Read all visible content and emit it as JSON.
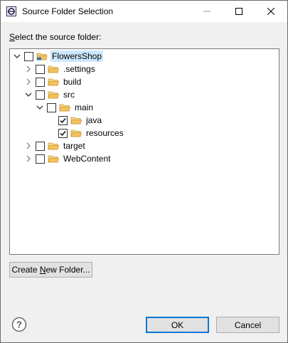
{
  "window": {
    "title": "Source Folder Selection"
  },
  "prompt": {
    "mnemonic": "S",
    "rest": "elect the source folder:"
  },
  "tree": [
    {
      "label": "FlowersShop",
      "level": 0,
      "expanded": true,
      "checked": false,
      "icon": "project-folder-icon",
      "selected": true
    },
    {
      "label": ".settings",
      "level": 1,
      "expanded": false,
      "checked": false,
      "icon": "folder-icon"
    },
    {
      "label": "build",
      "level": 1,
      "expanded": false,
      "checked": false,
      "icon": "folder-icon"
    },
    {
      "label": "src",
      "level": 1,
      "expanded": true,
      "checked": false,
      "icon": "folder-icon"
    },
    {
      "label": "main",
      "level": 2,
      "expanded": true,
      "checked": false,
      "icon": "folder-icon"
    },
    {
      "label": "java",
      "level": 3,
      "expanded": null,
      "checked": true,
      "icon": "folder-icon"
    },
    {
      "label": "resources",
      "level": 3,
      "expanded": null,
      "checked": true,
      "icon": "folder-icon"
    },
    {
      "label": "target",
      "level": 1,
      "expanded": false,
      "checked": false,
      "icon": "folder-icon"
    },
    {
      "label": "WebContent",
      "level": 1,
      "expanded": false,
      "checked": false,
      "icon": "folder-icon"
    }
  ],
  "buttons": {
    "create_prefix": "Create ",
    "create_mnemonic": "N",
    "create_suffix": "ew Folder...",
    "ok": "OK",
    "cancel": "Cancel"
  },
  "colors": {
    "accent": "#0078d7",
    "selection": "#cce8ff",
    "folder": "#f5c25c"
  }
}
